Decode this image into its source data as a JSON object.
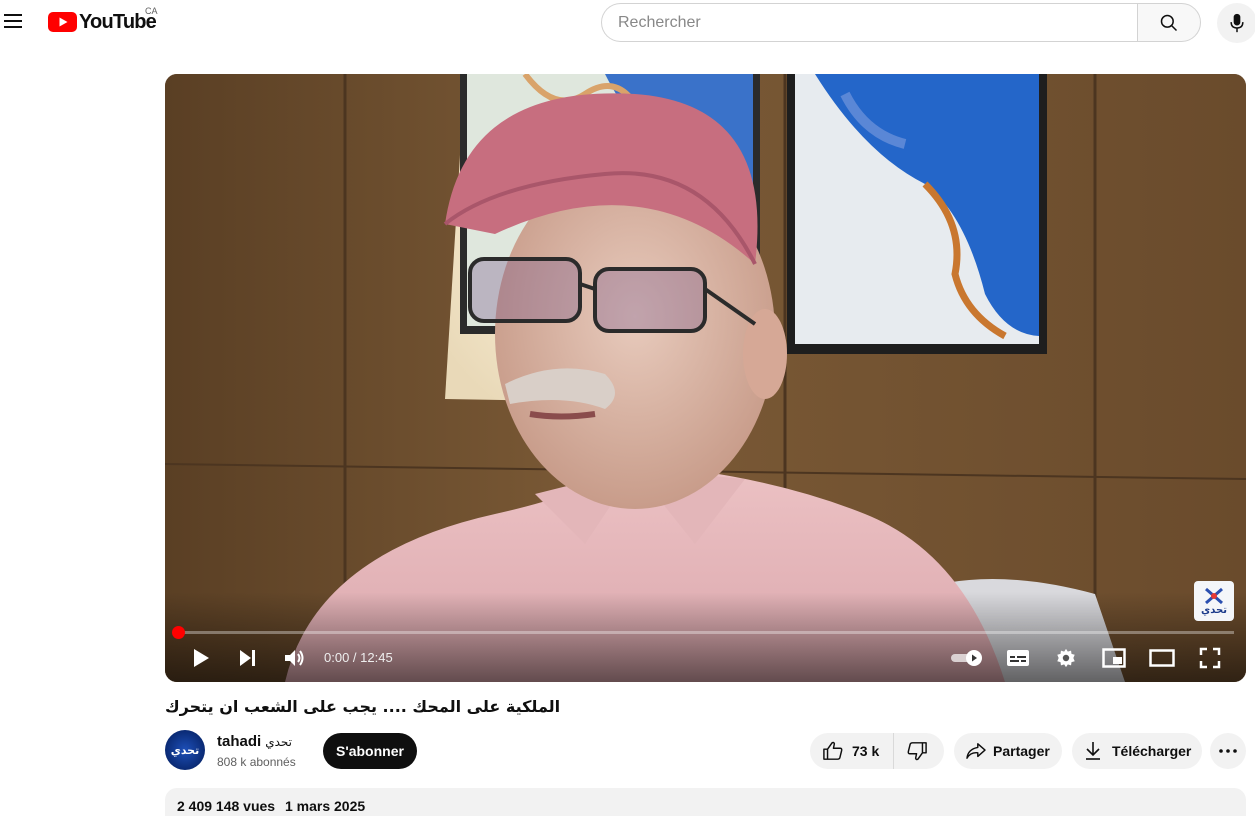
{
  "header": {
    "logo_text": "YouTube",
    "region": "CA",
    "search_placeholder": "Rechercher"
  },
  "player": {
    "time_current": "0:00",
    "time_separator": " / ",
    "time_total": "12:45",
    "progress_fraction": 0.0,
    "watermark_text": "تحدي",
    "controls": [
      "play-icon",
      "next-icon",
      "volume-icon",
      "autoplay-toggle",
      "subtitles-icon",
      "settings-icon",
      "miniplayer-icon",
      "theater-icon",
      "fullscreen-icon"
    ]
  },
  "video": {
    "title": "الملكية على المحك .... يجب على الشعب ان يتحرك"
  },
  "channel": {
    "name": "tahadi",
    "name_ar": "تحدي",
    "subscribers": "808 k abonnés",
    "avatar_text": "تحدي",
    "subscribe_label": "S'abonner"
  },
  "actions": {
    "likes": "73 k",
    "share_label": "Partager",
    "download_label": "Télécharger"
  },
  "description": {
    "views": "2 409 148 vues",
    "date": "1 mars 2025"
  },
  "colors": {
    "brand_red": "#ff0000",
    "button_dark": "#0f0f0f",
    "pill_bg": "#f2f2f2"
  }
}
